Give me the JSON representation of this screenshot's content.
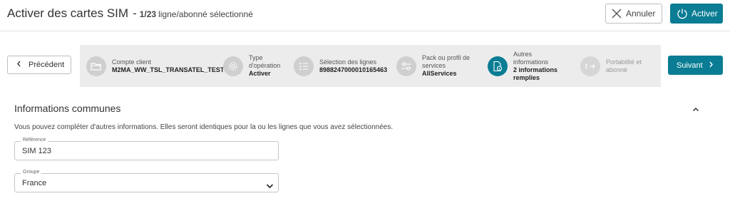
{
  "header": {
    "title": "Activer des cartes SIM",
    "dash": "-",
    "count": "1/23",
    "selection_text": "ligne/abonné sélectionné",
    "cancel_label": "Annuler",
    "activate_label": "Activer"
  },
  "nav": {
    "prev_label": "Précédent",
    "next_label": "Suivant"
  },
  "steps": [
    {
      "label": "Compte client",
      "value": "M2MA_WW_TSL_TRANSATEL_TEST",
      "icon": "folder-icon",
      "state": "done"
    },
    {
      "label": "Type d'opération",
      "label_lines": [
        "Type",
        "d'opération"
      ],
      "value": "Activer",
      "icon": "gear-icon",
      "state": "done"
    },
    {
      "label": "Sélection des lignes",
      "value": "8988247000010165463",
      "icon": "list-check-icon",
      "state": "done"
    },
    {
      "label": "Pack ou profil de services",
      "label_lines": [
        "Pack ou profil de",
        "services"
      ],
      "value": "AllServices",
      "icon": "sliders-icon",
      "state": "done"
    },
    {
      "label": "Autres informations",
      "label_lines": [
        "Autres",
        "informations"
      ],
      "value_lines": [
        "2 informations",
        "remplies"
      ],
      "icon": "document-info-icon",
      "state": "active"
    },
    {
      "label": "Portabilité et abonné",
      "label_lines": [
        "Portabilité et",
        "abonné"
      ],
      "value": "",
      "icon": "port-arrow-icon",
      "state": "pending"
    }
  ],
  "section": {
    "title": "Informations communes",
    "description": "Vous pouvez compléter d'autres informations. Elles seront identiques pour la ou les lignes que vous avez sélectionnées."
  },
  "fields": {
    "reference": {
      "label": "Référence",
      "value": "SIM 123"
    },
    "group": {
      "label": "Groupe",
      "value": "France"
    }
  },
  "colors": {
    "accent": "#0a7d94",
    "stepper_bg": "#ececec",
    "step_done": "#cfcfcf"
  }
}
